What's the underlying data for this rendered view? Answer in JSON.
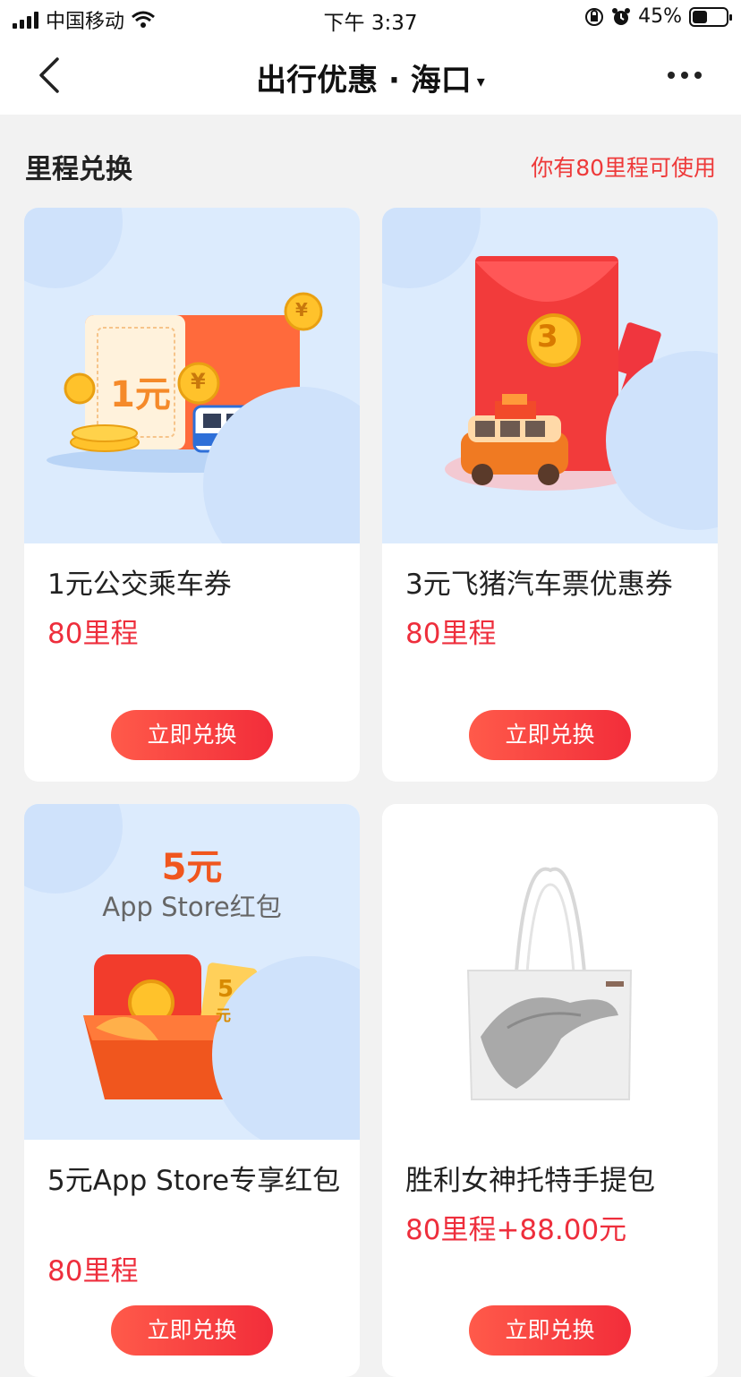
{
  "status": {
    "carrier": "中国移动",
    "time": "下午 3:37",
    "battery": "45%",
    "battery_level": 0.45
  },
  "nav": {
    "title": "出行优惠 · 海口",
    "caret": "▾"
  },
  "section": {
    "title": "里程兑换",
    "extra": "你有80里程可使用"
  },
  "cards": [
    {
      "name": "1元公交乘车券",
      "price": "80里程",
      "button": "立即兑换",
      "art": "1元"
    },
    {
      "name": "3元飞猪汽车票优惠券",
      "price": "80里程",
      "button": "立即兑换",
      "art": "3"
    },
    {
      "name": "5元App Store专享红包",
      "price": "80里程",
      "button": "立即兑换",
      "art_amount": "5元",
      "art_label": "App Store红包",
      "art_small": "5",
      "art_small_unit": "元"
    },
    {
      "name": "胜利女神托特手提包",
      "price": "80里程+88.00元",
      "button": "立即兑换"
    }
  ]
}
